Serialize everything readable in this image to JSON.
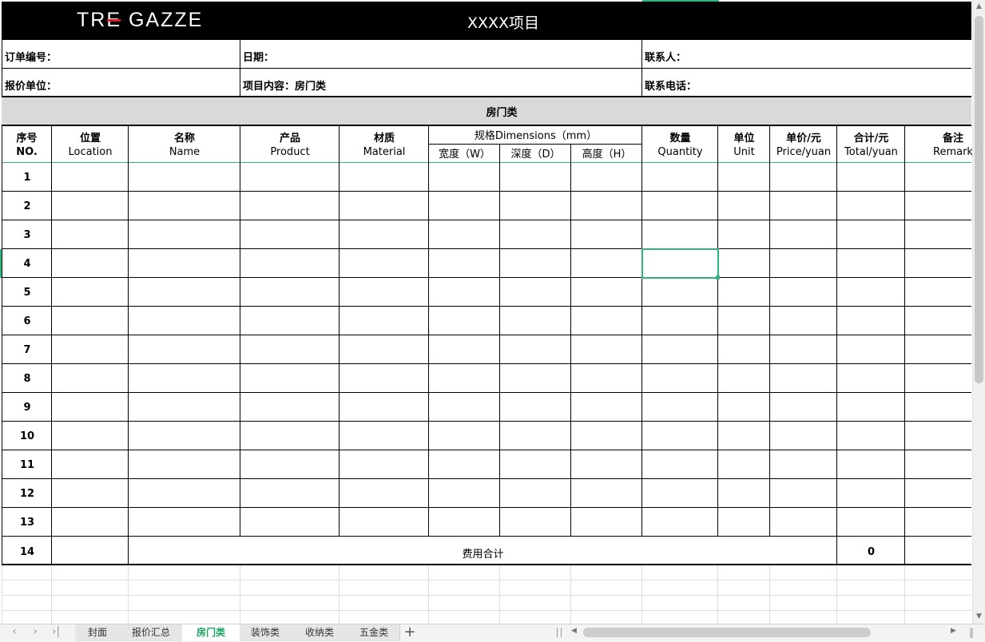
{
  "header": {
    "logo_text": "TRE GAZZE",
    "title": "XXXX项目"
  },
  "info": {
    "order_no": "订单编号：",
    "date": "日期：",
    "contact": "联系人：",
    "quote_unit": "报价单位：",
    "project_content": "项目内容：房门类",
    "phone": "联系电话："
  },
  "section_title": "房门类",
  "columns": {
    "seq": {
      "cn": "序号",
      "en": "NO."
    },
    "location": {
      "cn": "位置",
      "en": "Location"
    },
    "name": {
      "cn": "名称",
      "en": "Name"
    },
    "product": {
      "cn": "产品",
      "en": "Product"
    },
    "material": {
      "cn": "材质",
      "en": "Material"
    },
    "dimensions": "规格Dimensions（mm）",
    "width": "宽度（W）",
    "depth": "深度（D）",
    "height": "高度（H）",
    "quantity": {
      "cn": "数量",
      "en": "Quantity"
    },
    "unit": {
      "cn": "单位",
      "en": "Unit"
    },
    "price": {
      "cn": "单价/元",
      "en": "Price/yuan"
    },
    "total": {
      "cn": "合计/元",
      "en": "Total/yuan"
    },
    "remark": {
      "cn": "备注",
      "en": "Remark"
    }
  },
  "rows": [
    "1",
    "2",
    "3",
    "4",
    "5",
    "6",
    "7",
    "8",
    "9",
    "10",
    "11",
    "12",
    "13"
  ],
  "summary": {
    "no": "14",
    "label": "费用合计",
    "total": "0"
  },
  "tabs": [
    "封面",
    "报价汇总",
    "房门类",
    "装饰类",
    "收纳类",
    "五金类"
  ],
  "active_tab": "房门类",
  "colors": {
    "accent": "#2fb57a",
    "header_bg": "#000000",
    "band": "#d9d9d9",
    "active_tab": "#1aa260"
  }
}
